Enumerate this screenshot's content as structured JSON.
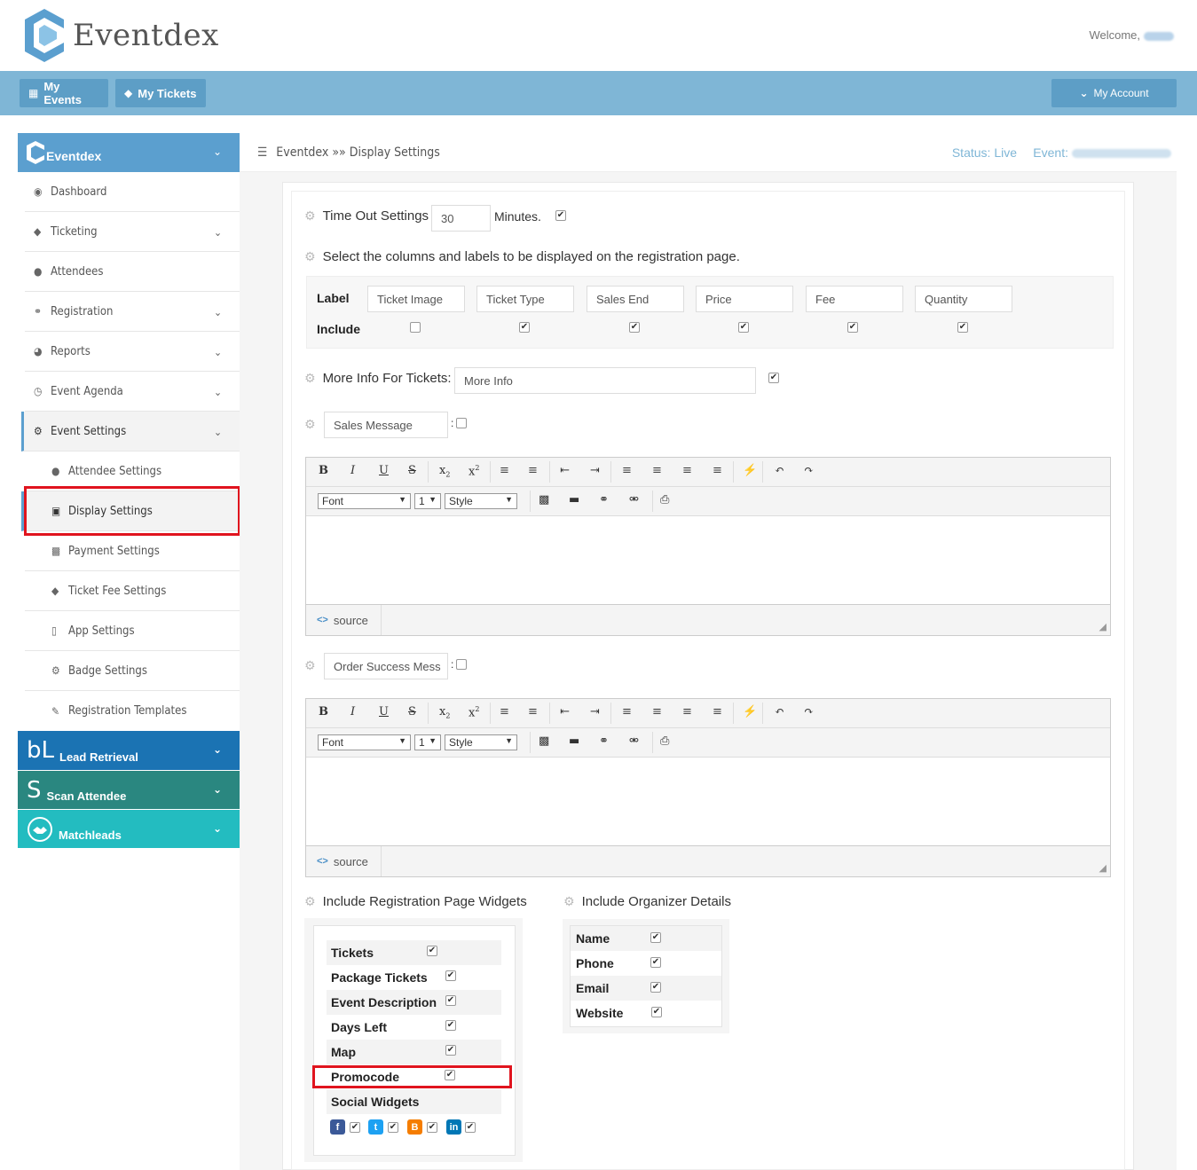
{
  "app": {
    "name": "Eventdex",
    "welcome": "Welcome,"
  },
  "navbar": {
    "my_events": "My Events",
    "my_tickets": "My Tickets",
    "my_account": "My Account"
  },
  "sidebar": {
    "header": "Eventdex",
    "items": [
      {
        "label": "Dashboard",
        "icon": "dashboard-icon"
      },
      {
        "label": "Ticketing",
        "icon": "ticket-icon"
      },
      {
        "label": "Attendees",
        "icon": "user-icon"
      },
      {
        "label": "Registration",
        "icon": "link-icon"
      },
      {
        "label": "Reports",
        "icon": "pie-chart-icon"
      },
      {
        "label": "Event Agenda",
        "icon": "clock-icon"
      },
      {
        "label": "Event Settings",
        "icon": "gear-icon"
      }
    ],
    "sub_items": [
      {
        "label": "Attendee Settings",
        "icon": "user-icon"
      },
      {
        "label": "Display Settings",
        "icon": "monitor-icon"
      },
      {
        "label": "Payment Settings",
        "icon": "money-icon"
      },
      {
        "label": "Ticket Fee Settings",
        "icon": "ticket-icon"
      },
      {
        "label": "App Settings",
        "icon": "mobile-icon"
      },
      {
        "label": "Badge Settings",
        "icon": "gear-icon"
      },
      {
        "label": "Registration Templates",
        "icon": "edit-icon"
      }
    ],
    "modules": [
      {
        "label": "Lead Retrieval",
        "glyph": "bL",
        "color": "#1b73b3"
      },
      {
        "label": "Scan Attendee",
        "glyph": "S",
        "color": "#2a8780"
      },
      {
        "label": "Matchleads",
        "glyph": "",
        "color": "#23bcc0"
      }
    ]
  },
  "breadcrumb": {
    "text": "Eventdex »» Display Settings",
    "status": "Status: Live",
    "event_label": "Event:"
  },
  "settings": {
    "timeout_label": "Time Out Settings",
    "timeout_value": "30",
    "timeout_unit": "Minutes.",
    "columns_label": "Select the columns and labels to be displayed on the registration page.",
    "grid_label": "Label",
    "grid_include": "Include",
    "columns": [
      {
        "label": "Ticket Image",
        "checked": false
      },
      {
        "label": "Ticket Type",
        "checked": true
      },
      {
        "label": "Sales End",
        "checked": true
      },
      {
        "label": "Price",
        "checked": true
      },
      {
        "label": "Fee",
        "checked": true
      },
      {
        "label": "Quantity",
        "checked": true
      }
    ],
    "more_info_label": "More Info For Tickets:",
    "more_info_value": "More Info",
    "sales_message": "Sales Message",
    "order_success": "Order Success Mess",
    "editor": {
      "font": "Font",
      "size": "1",
      "style": "Style",
      "source": "source"
    },
    "widgets_label": "Include Registration Page Widgets",
    "widgets": [
      {
        "label": "Tickets"
      },
      {
        "label": "Package Tickets"
      },
      {
        "label": "Event Description"
      },
      {
        "label": "Days Left"
      },
      {
        "label": "Map"
      },
      {
        "label": "Promocode"
      },
      {
        "label": "Social Widgets"
      }
    ],
    "organizer_label": "Include Organizer Details",
    "organizer": [
      {
        "label": "Name"
      },
      {
        "label": "Phone"
      },
      {
        "label": "Email"
      },
      {
        "label": "Website"
      }
    ],
    "social_icons": [
      "facebook-icon",
      "twitter-icon",
      "blogger-icon",
      "linkedin-icon"
    ]
  }
}
